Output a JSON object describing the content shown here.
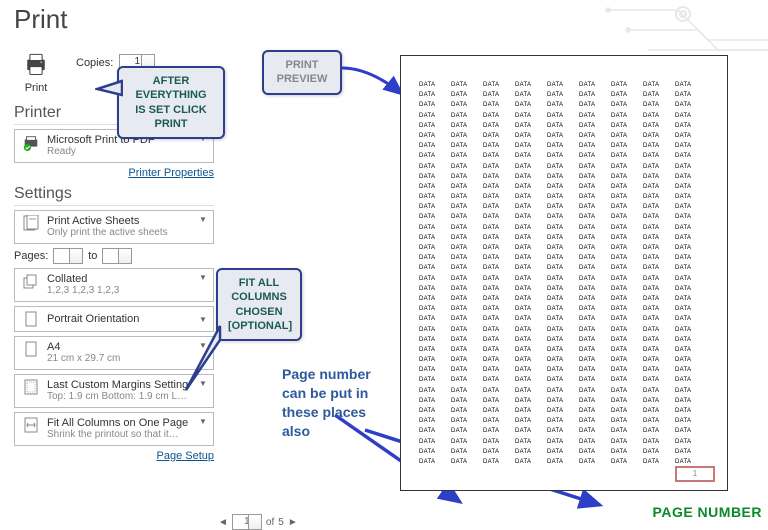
{
  "title": "Print",
  "print_button_label": "Print",
  "copies": {
    "label": "Copies:",
    "value": "1"
  },
  "printer": {
    "header": "Printer",
    "name": "Microsoft Print to PDF",
    "status": "Ready",
    "properties_link": "Printer Properties"
  },
  "settings": {
    "header": "Settings",
    "print_what": {
      "main": "Print Active Sheets",
      "sub": "Only print the active sheets"
    },
    "pages": {
      "label": "Pages:",
      "from": "",
      "to_label": "to",
      "to": ""
    },
    "collation": {
      "main": "Collated",
      "sub": "1,2,3   1,2,3   1,2,3"
    },
    "orientation": {
      "main": "Portrait Orientation"
    },
    "paper": {
      "main": "A4",
      "sub": "21 cm x 29.7 cm"
    },
    "margins": {
      "main": "Last Custom Margins Setting",
      "sub": "Top: 1.9 cm Bottom: 1.9 cm L…"
    },
    "scaling": {
      "main": "Fit All Columns on One Page",
      "sub": "Shrink the printout so that it…"
    },
    "page_setup_link": "Page Setup"
  },
  "callouts": {
    "print": "AFTER EVERYTHING IS SET CLICK PRINT",
    "preview": "PRINT PREVIEW",
    "fit": "FIT ALL COLUMNS CHOSEN [OPTIONAL]"
  },
  "annotation": "Page number can be put in these places also",
  "page_number_label": "PAGE NUMBER",
  "preview_page_number": "1",
  "data_cell": "DATA",
  "pager": {
    "page": "1",
    "of_label": "of",
    "total": "5"
  }
}
